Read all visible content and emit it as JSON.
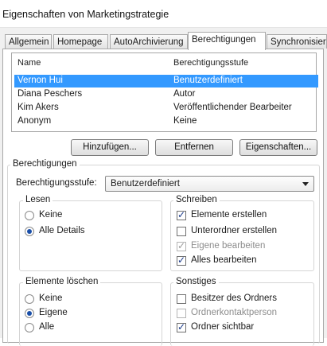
{
  "window": {
    "title": "Eigenschaften von Marketingstrategie"
  },
  "tabs": [
    {
      "label": "Allgemein",
      "active": false
    },
    {
      "label": "Homepage",
      "active": false
    },
    {
      "label": "AutoArchivierung",
      "active": false
    },
    {
      "label": "Berechtigungen",
      "active": true
    },
    {
      "label": "Synchronisier",
      "active": false
    }
  ],
  "list": {
    "headers": {
      "name": "Name",
      "level": "Berechtigungsstufe"
    },
    "rows": [
      {
        "name": "Vernon Hui",
        "level": "Benutzerdefiniert",
        "selected": true
      },
      {
        "name": "Diana Peschers",
        "level": "Autor",
        "selected": false
      },
      {
        "name": "Kim Akers",
        "level": "Veröffentlichender Bearbeiter",
        "selected": false
      },
      {
        "name": "Anonym",
        "level": "Keine",
        "selected": false
      }
    ]
  },
  "buttons": {
    "add": "Hinzufügen...",
    "remove": "Entfernen",
    "properties": "Eigenschaften..."
  },
  "permissions": {
    "group_label": "Berechtigungen",
    "level_label": "Berechtigungsstufe:",
    "level_value": "Benutzerdefiniert"
  },
  "read": {
    "label": "Lesen",
    "options": [
      {
        "label": "Keine",
        "checked": false
      },
      {
        "label": "Alle Details",
        "checked": true
      }
    ]
  },
  "write": {
    "label": "Schreiben",
    "options": [
      {
        "label": "Elemente erstellen",
        "checked": true,
        "disabled": false
      },
      {
        "label": "Unterordner erstellen",
        "checked": false,
        "disabled": false
      },
      {
        "label": "Eigene bearbeiten",
        "checked": true,
        "disabled": true
      },
      {
        "label": "Alles bearbeiten",
        "checked": true,
        "disabled": false
      }
    ]
  },
  "delete": {
    "label": "Elemente löschen",
    "options": [
      {
        "label": "Keine",
        "checked": false
      },
      {
        "label": "Eigene",
        "checked": true
      },
      {
        "label": "Alle",
        "checked": false
      }
    ]
  },
  "other": {
    "label": "Sonstiges",
    "options": [
      {
        "label": "Besitzer des Ordners",
        "checked": false,
        "disabled": false
      },
      {
        "label": "Ordnerkontaktperson",
        "checked": false,
        "disabled": true
      },
      {
        "label": "Ordner sichtbar",
        "checked": true,
        "disabled": false
      }
    ]
  },
  "colors": {
    "selection": "#3399ff",
    "accent": "#1a4fa8"
  }
}
